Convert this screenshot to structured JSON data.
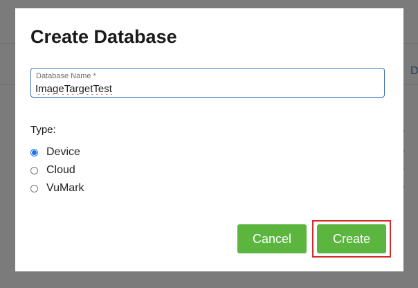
{
  "background": {
    "peek_text": "D"
  },
  "dialog": {
    "title": "Create Database",
    "name_field": {
      "label": "Database Name *",
      "value": "ImageTargetTest"
    },
    "type_label": "Type:",
    "type_options": [
      {
        "label": "Device",
        "checked": true
      },
      {
        "label": "Cloud",
        "checked": false
      },
      {
        "label": "VuMark",
        "checked": false
      }
    ],
    "buttons": {
      "cancel_label": "Cancel",
      "create_label": "Create"
    }
  },
  "colors": {
    "accent_green": "#5cb53f",
    "radio_blue": "#1a73e8",
    "field_border": "#3f73b7",
    "highlight_red": "#d42a2a"
  }
}
